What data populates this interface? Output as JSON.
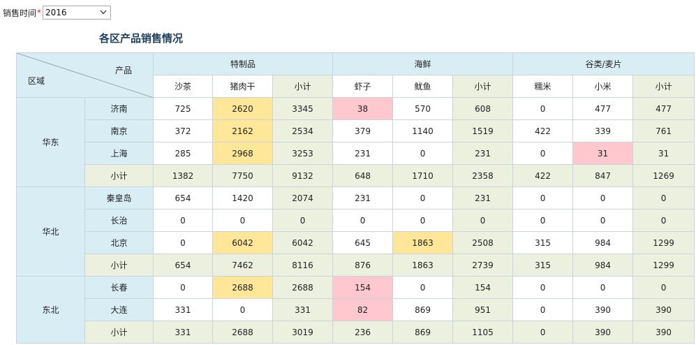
{
  "filter": {
    "label": "销售时间",
    "required_mark": "*",
    "year_value": "2016"
  },
  "report_title": "各区产品销售情况",
  "header": {
    "corner_product": "产品",
    "corner_region": "区域",
    "groups": [
      "特制品",
      "海鲜",
      "谷类/麦片"
    ],
    "products": [
      "沙茶",
      "猪肉干",
      "小计",
      "虾子",
      "鱿鱼",
      "小计",
      "糯米",
      "小米",
      "小计"
    ]
  },
  "regions": [
    {
      "name": "华东",
      "rows": [
        {
          "city": "济南",
          "values": [
            "725",
            "2620",
            "3345",
            "38",
            "570",
            "608",
            "0",
            "477",
            "477"
          ]
        },
        {
          "city": "南京",
          "values": [
            "372",
            "2162",
            "2534",
            "379",
            "1140",
            "1519",
            "422",
            "339",
            "761"
          ]
        },
        {
          "city": "上海",
          "values": [
            "285",
            "2968",
            "3253",
            "231",
            "0",
            "231",
            "0",
            "31",
            "31"
          ]
        },
        {
          "city": "小计",
          "values": [
            "1382",
            "7750",
            "9132",
            "648",
            "1710",
            "2358",
            "422",
            "847",
            "1269"
          ]
        }
      ]
    },
    {
      "name": "华北",
      "rows": [
        {
          "city": "秦皇岛",
          "values": [
            "654",
            "1420",
            "2074",
            "231",
            "0",
            "231",
            "0",
            "0",
            "0"
          ]
        },
        {
          "city": "长治",
          "values": [
            "0",
            "0",
            "0",
            "0",
            "0",
            "0",
            "0",
            "0",
            "0"
          ]
        },
        {
          "city": "北京",
          "values": [
            "0",
            "6042",
            "6042",
            "645",
            "1863",
            "2508",
            "315",
            "984",
            "1299"
          ]
        },
        {
          "city": "小计",
          "values": [
            "654",
            "7462",
            "8116",
            "876",
            "1863",
            "2739",
            "315",
            "984",
            "1299"
          ]
        }
      ]
    },
    {
      "name": "东北",
      "rows": [
        {
          "city": "长春",
          "values": [
            "0",
            "2688",
            "2688",
            "154",
            "0",
            "154",
            "0",
            "0",
            "0"
          ]
        },
        {
          "city": "大连",
          "values": [
            "331",
            "0",
            "331",
            "82",
            "869",
            "951",
            "0",
            "390",
            "390"
          ]
        },
        {
          "city": "小计",
          "values": [
            "331",
            "2688",
            "3019",
            "236",
            "869",
            "1105",
            "0",
            "390",
            "390"
          ]
        }
      ]
    }
  ],
  "highlight_colors": {
    "yellow": "#ffe699",
    "pink": "#ffc7ce"
  },
  "icons": {
    "select_arrow": "chevron-down-icon"
  }
}
